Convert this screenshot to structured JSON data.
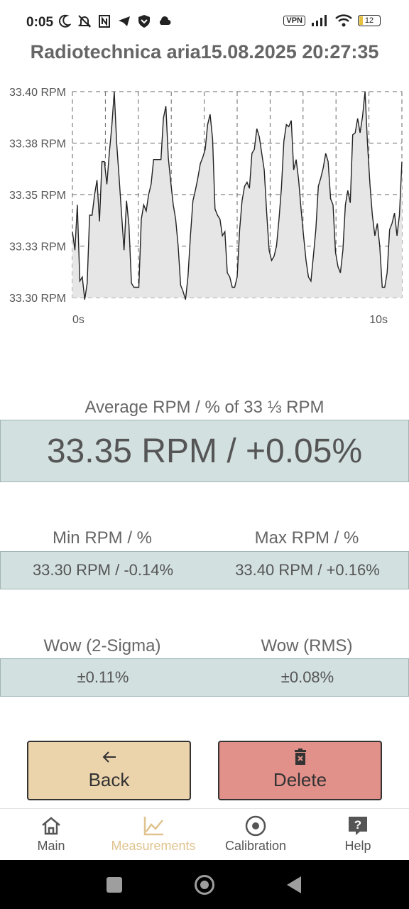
{
  "status_bar": {
    "time": "0:05",
    "vpn_label": "VPN",
    "battery": "12",
    "icons": [
      "moon-icon",
      "bell-off-icon",
      "nfc-icon",
      "telegram-icon",
      "shield-icon",
      "cloud-icon",
      "vpn-icon",
      "signal-icon",
      "wifi-icon",
      "battery-icon"
    ]
  },
  "title": "Radiotechnica aria15.08.2025 20:27:35",
  "chart_data": {
    "type": "area",
    "ylabels": [
      "33.40 RPM",
      "33.38 RPM",
      "33.35 RPM",
      "33.33 RPM",
      "33.30 RPM"
    ],
    "ylim": [
      33.3,
      33.4
    ],
    "xlabels": [
      "0s",
      "10s"
    ],
    "xlim": [
      0,
      10
    ],
    "grid": true,
    "values": [
      33.332,
      33.323,
      33.345,
      33.308,
      33.31,
      33.299,
      33.307,
      33.34,
      33.34,
      33.35,
      33.357,
      33.337,
      33.366,
      33.366,
      33.355,
      33.37,
      33.383,
      33.4,
      33.375,
      33.358,
      33.34,
      33.323,
      33.347,
      33.335,
      33.307,
      33.305,
      33.305,
      33.305,
      33.338,
      33.345,
      33.342,
      33.35,
      33.355,
      33.367,
      33.367,
      33.367,
      33.367,
      33.387,
      33.393,
      33.368,
      33.356,
      33.345,
      33.338,
      33.325,
      33.306,
      33.303,
      33.299,
      33.31,
      33.33,
      33.347,
      33.352,
      33.358,
      33.365,
      33.368,
      33.372,
      33.384,
      33.389,
      33.377,
      33.343,
      33.34,
      33.338,
      33.33,
      33.332,
      33.312,
      33.31,
      33.305,
      33.305,
      33.31,
      33.333,
      33.347,
      33.354,
      33.356,
      33.353,
      33.37,
      33.372,
      33.382,
      33.378,
      33.37,
      33.362,
      33.341,
      33.323,
      33.318,
      33.32,
      33.325,
      33.338,
      33.353,
      33.376,
      33.384,
      33.383,
      33.386,
      33.362,
      33.367,
      33.357,
      33.343,
      33.33,
      33.318,
      33.31,
      33.308,
      33.32,
      33.333,
      33.354,
      33.358,
      33.363,
      33.37,
      33.366,
      33.348,
      33.345,
      33.322,
      33.315,
      33.312,
      33.323,
      33.345,
      33.352,
      33.346,
      33.379,
      33.38,
      33.387,
      33.38,
      33.388,
      33.4,
      33.375,
      33.355,
      33.34,
      33.33,
      33.336,
      33.325,
      33.305,
      33.305,
      33.312,
      33.333,
      33.336,
      33.341,
      33.33,
      33.34,
      33.366
    ]
  },
  "average": {
    "label": "Average RPM / % of 33 ⅓ RPM",
    "value": "33.35 RPM / +0.05%"
  },
  "min": {
    "label": "Min RPM / %",
    "value": "33.30 RPM / -0.14%"
  },
  "max": {
    "label": "Max RPM / %",
    "value": "33.40 RPM / +0.16%"
  },
  "wow2": {
    "label": "Wow (2-Sigma)",
    "value": "±0.11%"
  },
  "wowrms": {
    "label": "Wow (RMS)",
    "value": "±0.08%"
  },
  "buttons": {
    "back": "Back",
    "delete": "Delete"
  },
  "nav": [
    {
      "label": "Main"
    },
    {
      "label": "Measurements"
    },
    {
      "label": "Calibration"
    },
    {
      "label": "Help"
    }
  ],
  "colors": {
    "accent": "#e0c38e",
    "box": "#d3e0e0",
    "back": "#ebd3ab",
    "delete": "#e2908a"
  }
}
